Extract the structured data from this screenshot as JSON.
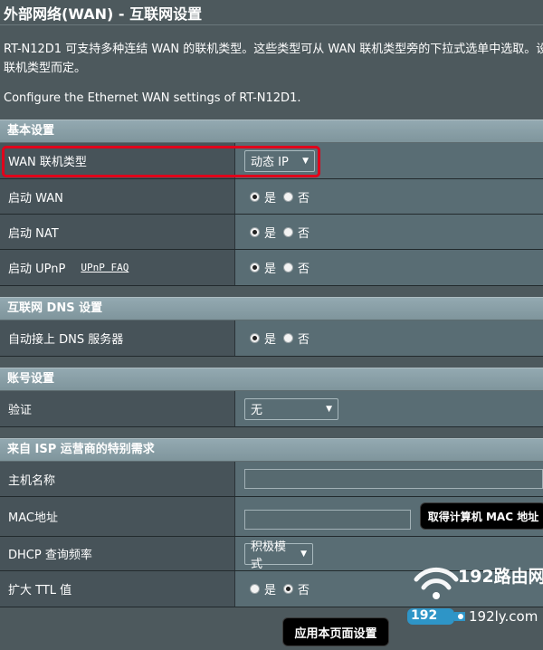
{
  "title": "外部网络(WAN) - 互联网设置",
  "description_line1": "RT-N12D1 可支持多种连结 WAN 的联机类型。这些类型可从 WAN 联机类型旁的下拉式选单中选取。设置",
  "description_line2": "联机类型而定。",
  "description_en": "Configure the Ethernet WAN settings of RT-N12D1.",
  "sections": {
    "basic": {
      "header": "基本设置",
      "wan_type": {
        "label": "WAN 联机类型",
        "value": "动态 IP"
      },
      "enable_wan": {
        "label": "启动 WAN",
        "yes": "是",
        "no": "否"
      },
      "enable_nat": {
        "label": "启动 NAT",
        "yes": "是",
        "no": "否"
      },
      "enable_upnp": {
        "label": "启动 UPnP",
        "faq": "UPnP FAQ",
        "yes": "是",
        "no": "否"
      }
    },
    "dns": {
      "header": "互联网 DNS 设置",
      "auto_dns": {
        "label": "自动接上 DNS 服务器",
        "yes": "是",
        "no": "否"
      }
    },
    "account": {
      "header": "账号设置",
      "auth": {
        "label": "验证",
        "value": "无"
      }
    },
    "isp": {
      "header": "来自 ISP 运营商的特别需求",
      "hostname": {
        "label": "主机名称",
        "value": ""
      },
      "mac": {
        "label": "MAC地址",
        "value": "",
        "button": "取得计算机 MAC 地址"
      },
      "dhcp": {
        "label": "DHCP 查询频率",
        "value": "积极模式"
      },
      "ttl": {
        "label": "扩大 TTL 值",
        "yes": "是",
        "no": "否"
      }
    }
  },
  "apply_button": "应用本页面设置",
  "watermark": {
    "text1": "192路由网",
    "text2": "192",
    "text3": "192ly.com"
  }
}
